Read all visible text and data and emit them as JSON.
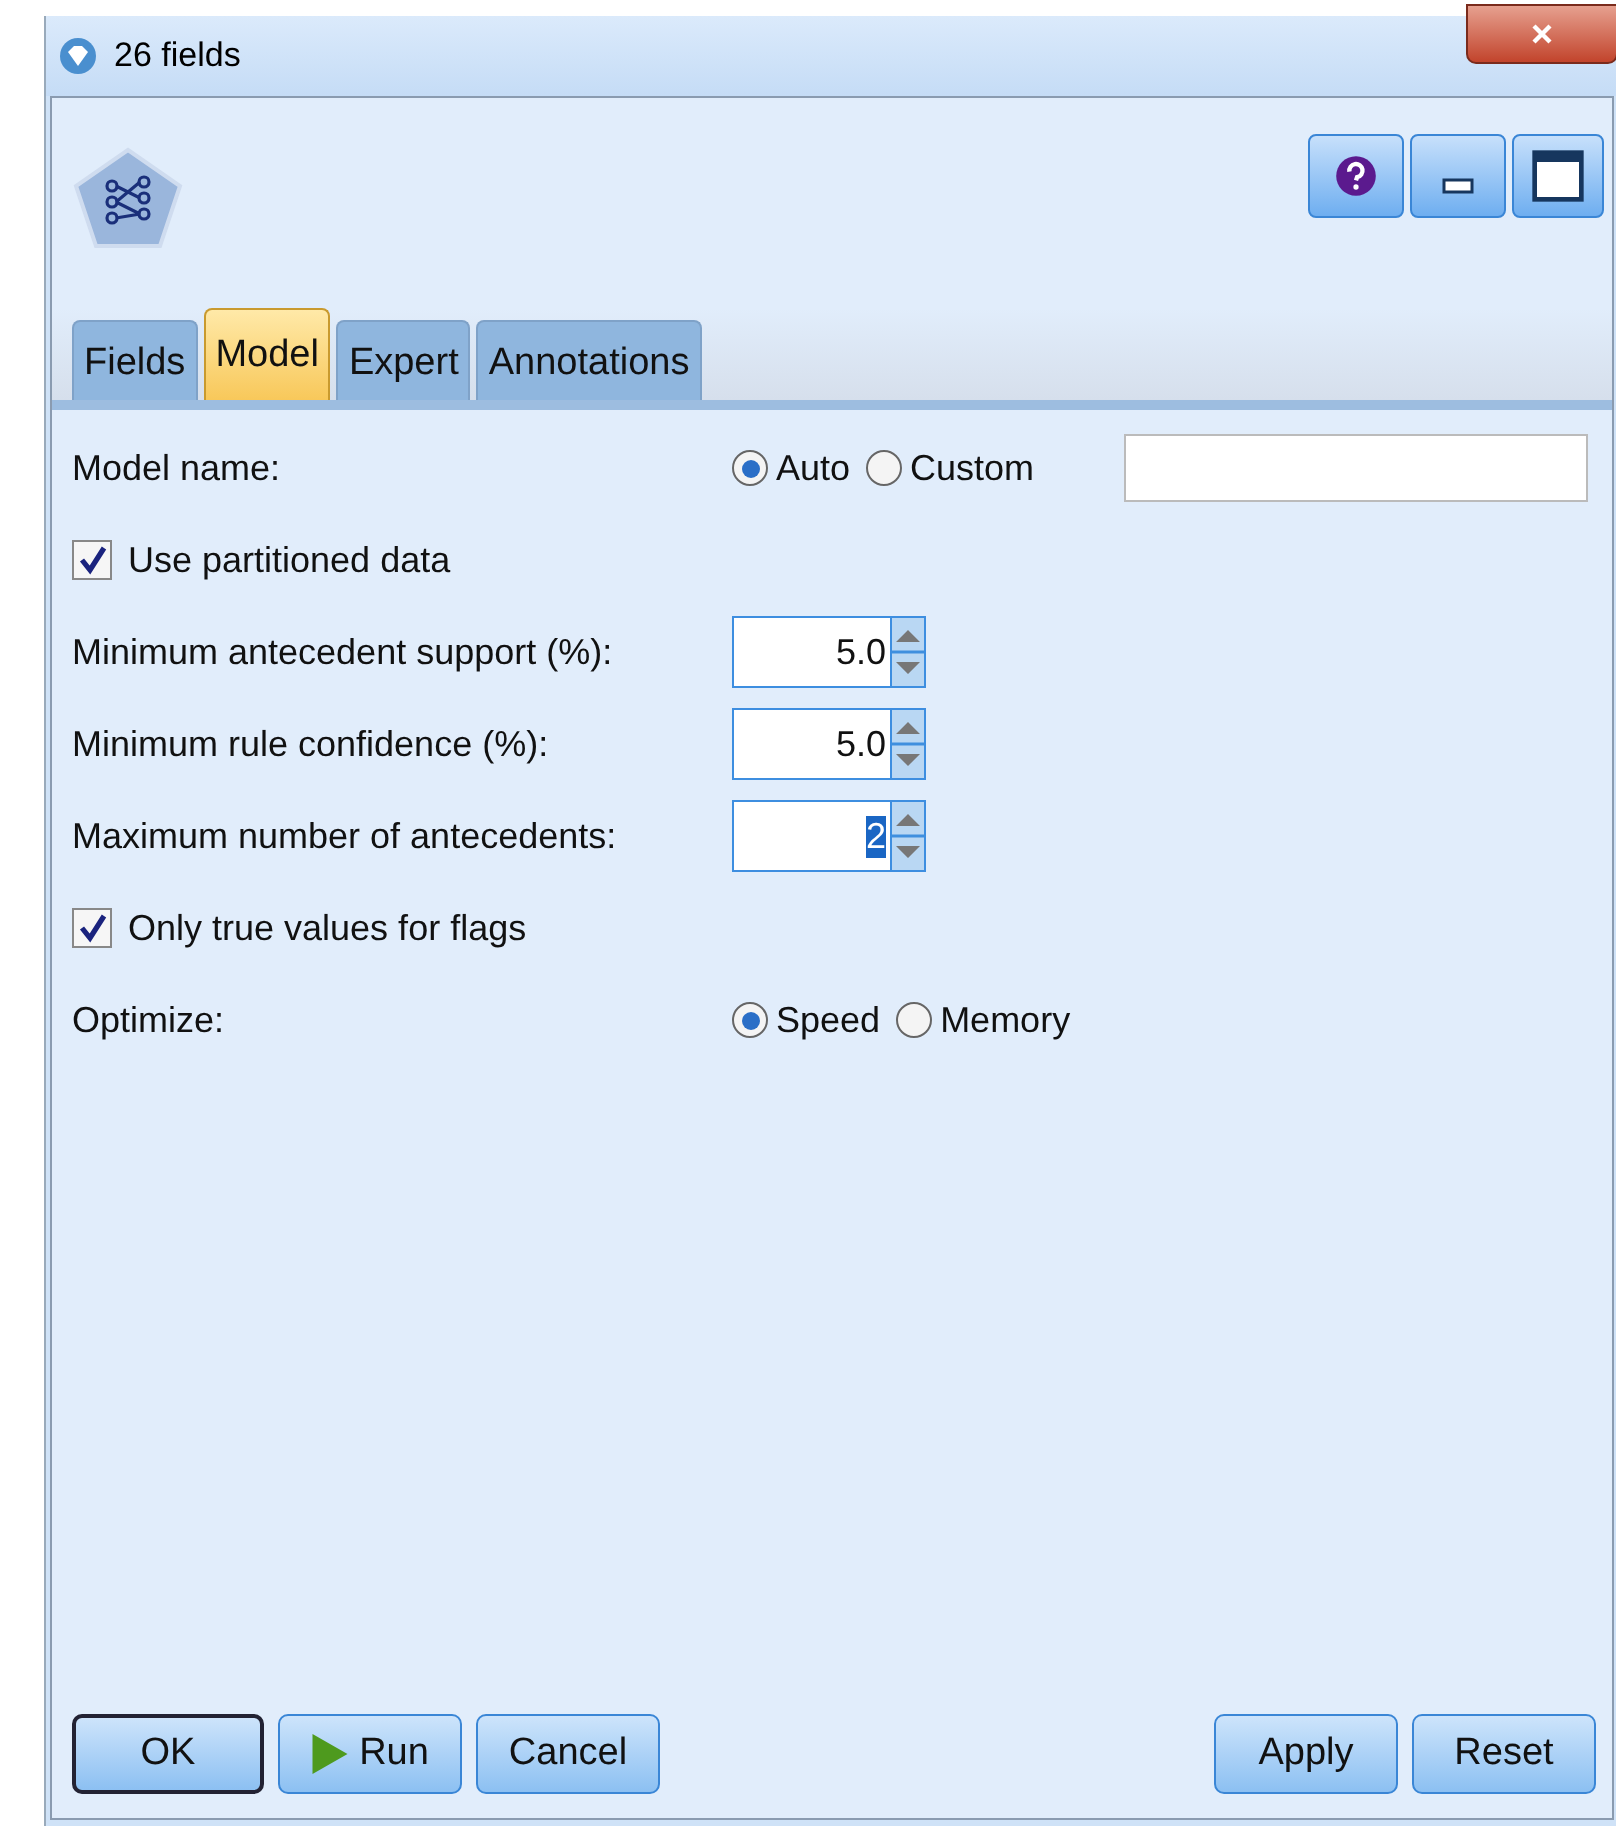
{
  "window": {
    "title": "26 fields"
  },
  "tabs": [
    {
      "label": "Fields",
      "selected": false
    },
    {
      "label": "Model",
      "selected": true
    },
    {
      "label": "Expert",
      "selected": false
    },
    {
      "label": "Annotations",
      "selected": false
    }
  ],
  "model_name": {
    "label": "Model name:",
    "options": [
      {
        "label": "Auto",
        "selected": true
      },
      {
        "label": "Custom",
        "selected": false
      }
    ]
  },
  "use_partitioned_data": {
    "label": "Use partitioned data",
    "checked": true
  },
  "spinners": [
    {
      "label": "Minimum antecedent support (%):",
      "value": "5.0",
      "highlighted": false
    },
    {
      "label": "Minimum rule confidence (%):",
      "value": "5.0",
      "highlighted": false
    },
    {
      "label": "Maximum number of antecedents:",
      "value": "2",
      "highlighted": true
    }
  ],
  "only_true_values": {
    "label": "Only true values for flags",
    "checked": true
  },
  "optimize": {
    "label": "Optimize:",
    "options": [
      {
        "label": "Speed",
        "selected": true
      },
      {
        "label": "Memory",
        "selected": false
      }
    ]
  },
  "buttons_left": [
    {
      "label": "OK",
      "kind": "default"
    },
    {
      "label": "Run",
      "kind": "run"
    },
    {
      "label": "Cancel",
      "kind": "plain"
    }
  ],
  "buttons_right": [
    {
      "label": "Apply"
    },
    {
      "label": "Reset"
    }
  ]
}
